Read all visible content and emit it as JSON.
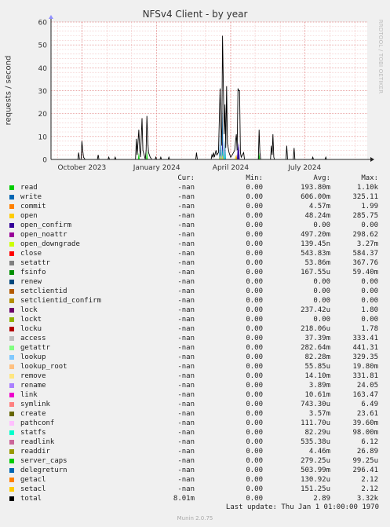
{
  "chart_data": {
    "type": "area",
    "title": "NFSv4 Client - by year",
    "ylabel": "requests / second",
    "ylim": [
      0,
      60
    ],
    "yticks": [
      0,
      10,
      20,
      30,
      40,
      50,
      60
    ],
    "xlim": [
      "2023-08-24",
      "2024-09-16"
    ],
    "xticks": [
      {
        "label": "October 2023",
        "date": "2023-10-01"
      },
      {
        "label": "January 2024",
        "date": "2024-01-01"
      },
      {
        "label": "April 2024",
        "date": "2024-04-01"
      },
      {
        "label": "July 2024",
        "date": "2024-07-01"
      }
    ],
    "total_series": {
      "name": "total",
      "points": [
        [
          "2023-09-26",
          0
        ],
        [
          "2023-09-27",
          3
        ],
        [
          "2023-09-28",
          0
        ],
        [
          "2023-09-30",
          0
        ],
        [
          "2023-10-01",
          8
        ],
        [
          "2023-10-02",
          4
        ],
        [
          "2023-10-03",
          1
        ],
        [
          "2023-10-05",
          0
        ],
        [
          "2023-10-20",
          0
        ],
        [
          "2023-10-21",
          2
        ],
        [
          "2023-10-22",
          0
        ],
        [
          "2023-11-02",
          0
        ],
        [
          "2023-11-03",
          1
        ],
        [
          "2023-11-04",
          0
        ],
        [
          "2023-11-10",
          0
        ],
        [
          "2023-11-11",
          1
        ],
        [
          "2023-11-12",
          0
        ],
        [
          "2023-12-06",
          0
        ],
        [
          "2023-12-07",
          9
        ],
        [
          "2023-12-08",
          2
        ],
        [
          "2023-12-10",
          13
        ],
        [
          "2023-12-11",
          5
        ],
        [
          "2023-12-12",
          1
        ],
        [
          "2023-12-14",
          18
        ],
        [
          "2023-12-15",
          4
        ],
        [
          "2023-12-18",
          0
        ],
        [
          "2023-12-19",
          4
        ],
        [
          "2023-12-20",
          19
        ],
        [
          "2023-12-21",
          8
        ],
        [
          "2023-12-22",
          3
        ],
        [
          "2023-12-24",
          1
        ],
        [
          "2023-12-26",
          0
        ],
        [
          "2023-12-30",
          0
        ],
        [
          "2023-12-31",
          1
        ],
        [
          "2024-01-01",
          0
        ],
        [
          "2024-01-05",
          0
        ],
        [
          "2024-01-06",
          1
        ],
        [
          "2024-01-07",
          0
        ],
        [
          "2024-01-15",
          0
        ],
        [
          "2024-01-16",
          1
        ],
        [
          "2024-01-17",
          0
        ],
        [
          "2024-02-18",
          0
        ],
        [
          "2024-02-19",
          3
        ],
        [
          "2024-02-20",
          0
        ],
        [
          "2024-03-08",
          0
        ],
        [
          "2024-03-09",
          2
        ],
        [
          "2024-03-10",
          1
        ],
        [
          "2024-03-11",
          3
        ],
        [
          "2024-03-12",
          1
        ],
        [
          "2024-03-14",
          4
        ],
        [
          "2024-03-15",
          2
        ],
        [
          "2024-03-17",
          3
        ],
        [
          "2024-03-19",
          31
        ],
        [
          "2024-03-20",
          15
        ],
        [
          "2024-03-21",
          6
        ],
        [
          "2024-03-22",
          54
        ],
        [
          "2024-03-23",
          33
        ],
        [
          "2024-03-24",
          11
        ],
        [
          "2024-03-25",
          24
        ],
        [
          "2024-03-26",
          5
        ],
        [
          "2024-03-27",
          32
        ],
        [
          "2024-03-28",
          7
        ],
        [
          "2024-03-30",
          3
        ],
        [
          "2024-04-01",
          1
        ],
        [
          "2024-04-03",
          2
        ],
        [
          "2024-04-06",
          4
        ],
        [
          "2024-04-07",
          8
        ],
        [
          "2024-04-08",
          11
        ],
        [
          "2024-04-09",
          4
        ],
        [
          "2024-04-10",
          31
        ],
        [
          "2024-04-11",
          30
        ],
        [
          "2024-04-12",
          30
        ],
        [
          "2024-04-13",
          3
        ],
        [
          "2024-04-14",
          1
        ],
        [
          "2024-04-17",
          3
        ],
        [
          "2024-04-18",
          0
        ],
        [
          "2024-05-05",
          0
        ],
        [
          "2024-05-06",
          13
        ],
        [
          "2024-05-07",
          3
        ],
        [
          "2024-05-08",
          0
        ],
        [
          "2024-05-20",
          0
        ],
        [
          "2024-05-21",
          6
        ],
        [
          "2024-05-22",
          2
        ],
        [
          "2024-05-23",
          11
        ],
        [
          "2024-05-24",
          1
        ],
        [
          "2024-05-25",
          0
        ],
        [
          "2024-06-08",
          0
        ],
        [
          "2024-06-09",
          6
        ],
        [
          "2024-06-10",
          0
        ],
        [
          "2024-06-17",
          0
        ],
        [
          "2024-06-18",
          5
        ],
        [
          "2024-06-19",
          0
        ],
        [
          "2024-07-10",
          0
        ],
        [
          "2024-07-11",
          1
        ],
        [
          "2024-07-12",
          0
        ],
        [
          "2024-07-26",
          0
        ],
        [
          "2024-07-27",
          1
        ],
        [
          "2024-07-28",
          0
        ]
      ]
    },
    "component_spikes": [
      {
        "color": "#00CC00",
        "points": [
          [
            "2023-12-10",
            3
          ],
          [
            "2023-12-20",
            4
          ],
          [
            "2024-03-19",
            6
          ],
          [
            "2024-03-22",
            9
          ],
          [
            "2024-04-10",
            3
          ],
          [
            "2024-05-06",
            3
          ]
        ]
      },
      {
        "color": "#0066B3",
        "points": [
          [
            "2024-03-19",
            12
          ],
          [
            "2024-03-22",
            22
          ],
          [
            "2024-03-25",
            9
          ],
          [
            "2024-04-10",
            7
          ]
        ]
      },
      {
        "color": "#330099",
        "points": [
          [
            "2024-03-22",
            8
          ],
          [
            "2024-04-10",
            8
          ],
          [
            "2024-04-11",
            7
          ]
        ]
      },
      {
        "color": "#FF8000",
        "points": [
          [
            "2024-03-22",
            3
          ],
          [
            "2024-04-08",
            2
          ]
        ]
      },
      {
        "color": "#00CCCC",
        "points": [
          [
            "2024-03-22",
            5
          ],
          [
            "2024-03-25",
            4
          ]
        ]
      },
      {
        "color": "#E7E13B",
        "points": [
          [
            "2024-03-19",
            2
          ],
          [
            "2024-03-22",
            2
          ],
          [
            "2024-04-07",
            2
          ]
        ]
      }
    ],
    "legend_headers": {
      "cur": "Cur:",
      "min": "Min:",
      "avg": "Avg:",
      "max": "Max:"
    },
    "legend": [
      {
        "name": "read",
        "color": "#00CC00",
        "cur": "-nan",
        "min": "0.00",
        "avg": "193.80m",
        "max": "1.10k"
      },
      {
        "name": "write",
        "color": "#0066B3",
        "cur": "-nan",
        "min": "0.00",
        "avg": "606.00m",
        "max": "325.11"
      },
      {
        "name": "commit",
        "color": "#FF8000",
        "cur": "-nan",
        "min": "0.00",
        "avg": "4.57m",
        "max": "1.99"
      },
      {
        "name": "open",
        "color": "#FFCC00",
        "cur": "-nan",
        "min": "0.00",
        "avg": "48.24m",
        "max": "285.75"
      },
      {
        "name": "open_confirm",
        "color": "#330099",
        "cur": "-nan",
        "min": "0.00",
        "avg": "0.00",
        "max": "0.00"
      },
      {
        "name": "open_noattr",
        "color": "#990099",
        "cur": "-nan",
        "min": "0.00",
        "avg": "497.20m",
        "max": "298.62"
      },
      {
        "name": "open_downgrade",
        "color": "#CCFF00",
        "cur": "-nan",
        "min": "0.00",
        "avg": "139.45n",
        "max": "3.27m"
      },
      {
        "name": "close",
        "color": "#FF0000",
        "cur": "-nan",
        "min": "0.00",
        "avg": "543.83m",
        "max": "584.37"
      },
      {
        "name": "setattr",
        "color": "#808080",
        "cur": "-nan",
        "min": "0.00",
        "avg": "53.86m",
        "max": "367.76"
      },
      {
        "name": "fsinfo",
        "color": "#008F00",
        "cur": "-nan",
        "min": "0.00",
        "avg": "167.55u",
        "max": "59.40m"
      },
      {
        "name": "renew",
        "color": "#00487D",
        "cur": "-nan",
        "min": "0.00",
        "avg": "0.00",
        "max": "0.00"
      },
      {
        "name": "setclientid",
        "color": "#B35A00",
        "cur": "-nan",
        "min": "0.00",
        "avg": "0.00",
        "max": "0.00"
      },
      {
        "name": "setclientid_confirm",
        "color": "#B38F00",
        "cur": "-nan",
        "min": "0.00",
        "avg": "0.00",
        "max": "0.00"
      },
      {
        "name": "lock",
        "color": "#6B006B",
        "cur": "-nan",
        "min": "0.00",
        "avg": "237.42u",
        "max": "1.80"
      },
      {
        "name": "lockt",
        "color": "#8FB300",
        "cur": "-nan",
        "min": "0.00",
        "avg": "0.00",
        "max": "0.00"
      },
      {
        "name": "locku",
        "color": "#B30000",
        "cur": "-nan",
        "min": "0.00",
        "avg": "218.06u",
        "max": "1.78"
      },
      {
        "name": "access",
        "color": "#BEBEBE",
        "cur": "-nan",
        "min": "0.00",
        "avg": "37.39m",
        "max": "333.41"
      },
      {
        "name": "getattr",
        "color": "#80FF80",
        "cur": "-nan",
        "min": "0.00",
        "avg": "282.64m",
        "max": "441.31"
      },
      {
        "name": "lookup",
        "color": "#80C9FF",
        "cur": "-nan",
        "min": "0.00",
        "avg": "82.28m",
        "max": "329.35"
      },
      {
        "name": "lookup_root",
        "color": "#FFC080",
        "cur": "-nan",
        "min": "0.00",
        "avg": "55.85u",
        "max": "19.80m"
      },
      {
        "name": "remove",
        "color": "#FFE680",
        "cur": "-nan",
        "min": "0.00",
        "avg": "14.10m",
        "max": "331.81"
      },
      {
        "name": "rename",
        "color": "#AA80FF",
        "cur": "-nan",
        "min": "0.00",
        "avg": "3.89m",
        "max": "24.05"
      },
      {
        "name": "link",
        "color": "#EE00CC",
        "cur": "-nan",
        "min": "0.00",
        "avg": "10.61m",
        "max": "163.47"
      },
      {
        "name": "symlink",
        "color": "#FF8080",
        "cur": "-nan",
        "min": "0.00",
        "avg": "743.30u",
        "max": "6.49"
      },
      {
        "name": "create",
        "color": "#666600",
        "cur": "-nan",
        "min": "0.00",
        "avg": "3.57m",
        "max": "23.61"
      },
      {
        "name": "pathconf",
        "color": "#FFBFFF",
        "cur": "-nan",
        "min": "0.00",
        "avg": "111.70u",
        "max": "39.60m"
      },
      {
        "name": "statfs",
        "color": "#00FFCC",
        "cur": "-nan",
        "min": "0.00",
        "avg": "82.29u",
        "max": "98.00m"
      },
      {
        "name": "readlink",
        "color": "#CC6699",
        "cur": "-nan",
        "min": "0.00",
        "avg": "535.38u",
        "max": "6.12"
      },
      {
        "name": "readdir",
        "color": "#999900",
        "cur": "-nan",
        "min": "0.00",
        "avg": "4.46m",
        "max": "26.89"
      },
      {
        "name": "server_caps",
        "color": "#00CC00",
        "cur": "-nan",
        "min": "0.00",
        "avg": "279.25u",
        "max": "99.25u"
      },
      {
        "name": "delegreturn",
        "color": "#0066B3",
        "cur": "-nan",
        "min": "0.00",
        "avg": "503.99m",
        "max": "296.41"
      },
      {
        "name": "getacl",
        "color": "#FF8000",
        "cur": "-nan",
        "min": "0.00",
        "avg": "130.92u",
        "max": "2.12"
      },
      {
        "name": "setacl",
        "color": "#FFCC00",
        "cur": "-nan",
        "min": "0.00",
        "avg": "151.25u",
        "max": "2.12"
      },
      {
        "name": "total",
        "color": "#000000",
        "cur": "8.01m",
        "min": "0.00",
        "avg": "2.89",
        "max": "3.32k"
      }
    ]
  },
  "watermark": "RRDTOOL / TOBI OETIKER",
  "last_update": "Last update: Thu Jan  1 01:00:00 1970",
  "footer": "Munin 2.0.75"
}
